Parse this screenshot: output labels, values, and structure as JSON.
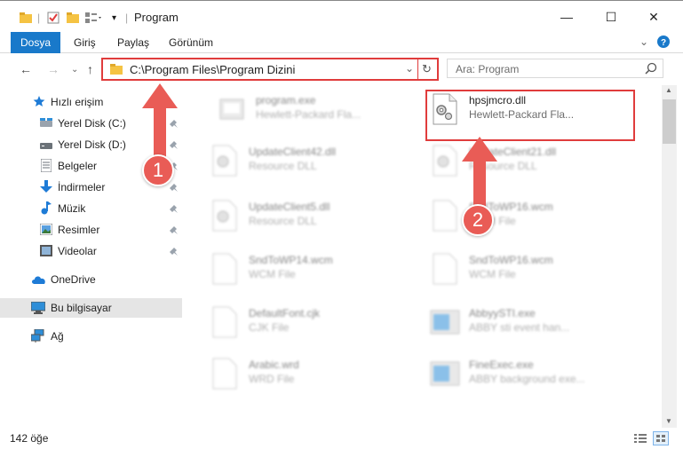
{
  "window": {
    "title": "Program",
    "minimize": "—",
    "maximize": "☐",
    "close": "✕"
  },
  "ribbon": {
    "file": "Dosya",
    "tabs": [
      "Giriş",
      "Paylaş",
      "Görünüm"
    ]
  },
  "address": {
    "path": "C:\\Program Files\\Program Dizini"
  },
  "search": {
    "placeholder": "Ara: Program"
  },
  "sidebar": {
    "quick_access": "Hızlı erişim",
    "items": [
      {
        "label": "Yerel Disk (C:)",
        "icon": "drive-icon"
      },
      {
        "label": "Yerel Disk (D:)",
        "icon": "drive-icon"
      },
      {
        "label": "Belgeler",
        "icon": "documents-icon"
      },
      {
        "label": "İndirmeler",
        "icon": "downloads-icon"
      },
      {
        "label": "Müzik",
        "icon": "music-icon"
      },
      {
        "label": "Resimler",
        "icon": "pictures-icon"
      },
      {
        "label": "Videolar",
        "icon": "videos-icon"
      }
    ],
    "onedrive": "OneDrive",
    "this_pc": "Bu bilgisayar",
    "network": "Ağ"
  },
  "files": {
    "left": [
      {
        "name": "program.exe",
        "type": "Hewlett-Packard Fla..."
      },
      {
        "name": "UpdateClient42.dll",
        "type": "Resource DLL"
      },
      {
        "name": "UpdateClient5.dll",
        "type": "Resource DLL"
      },
      {
        "name": "SndToWP14.wcm",
        "type": "WCM File"
      },
      {
        "name": "DefaultFont.cjk",
        "type": "CJK File"
      },
      {
        "name": "Arabic.wrd",
        "type": "WRD File"
      }
    ],
    "right": [
      {
        "name": "hpsjmcro.dll",
        "type": "Hewlett-Packard Fla..."
      },
      {
        "name": "UpdateClient21.dll",
        "type": "Resource DLL"
      },
      {
        "name": "SndToWP16.wcm",
        "type": "WCM File"
      },
      {
        "name": "SndToWP16.wcm",
        "type": "WCM File"
      },
      {
        "name": "AbbyySTI.exe",
        "type": "ABBY sti event han..."
      },
      {
        "name": "FineExec.exe",
        "type": "ABBY background exe..."
      }
    ]
  },
  "status": {
    "count": "142 öğe"
  },
  "annotations": {
    "step1": "1",
    "step2": "2",
    "color": "#e95c56"
  }
}
